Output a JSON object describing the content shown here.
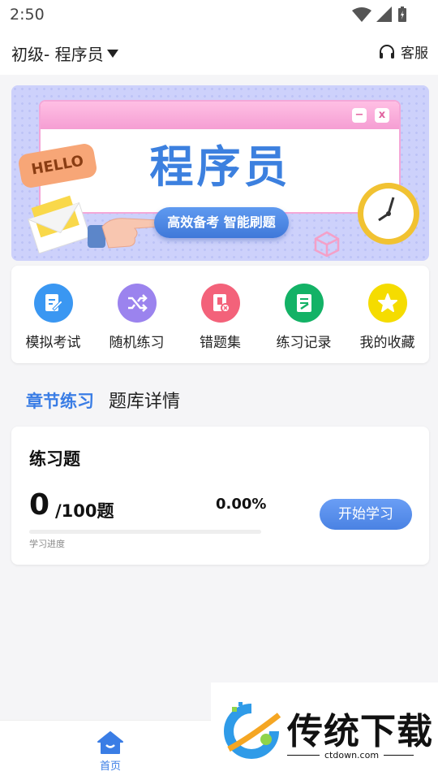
{
  "status_bar": {
    "time": "2:50"
  },
  "header": {
    "level_selector": "初级- 程序员",
    "service_label": "客服"
  },
  "banner": {
    "title": "程序员",
    "hello": "HELLO",
    "button": "高效备考 智能刷题",
    "window_buttons": [
      "−",
      "x"
    ]
  },
  "quick_actions": [
    {
      "label": "模拟考试",
      "icon": "edit-doc-icon",
      "color": "#3a97f2"
    },
    {
      "label": "随机练习",
      "icon": "shuffle-icon",
      "color": "#9b83ee"
    },
    {
      "label": "错题集",
      "icon": "error-file-icon",
      "color": "#f3627a"
    },
    {
      "label": "练习记录",
      "icon": "record-icon",
      "color": "#13b266"
    },
    {
      "label": "我的收藏",
      "icon": "star-icon",
      "color": "#f5dc00"
    }
  ],
  "tabs": [
    {
      "label": "章节练习",
      "active": true
    },
    {
      "label": "题库详情",
      "active": false
    }
  ],
  "practice_card": {
    "title": "练习题",
    "done": "0",
    "total": "/100题",
    "percent": "0.00%",
    "progress": 0,
    "progress_label": "学习进度",
    "start_button": "开始学习"
  },
  "bottom_nav": {
    "home_label": "首页"
  },
  "watermark": {
    "brand": "传统下载",
    "url": "ctdown.com"
  },
  "colors": {
    "accent": "#3a7de5",
    "banner_bg": "#cdd1fb",
    "pink": "#f59ed3"
  }
}
